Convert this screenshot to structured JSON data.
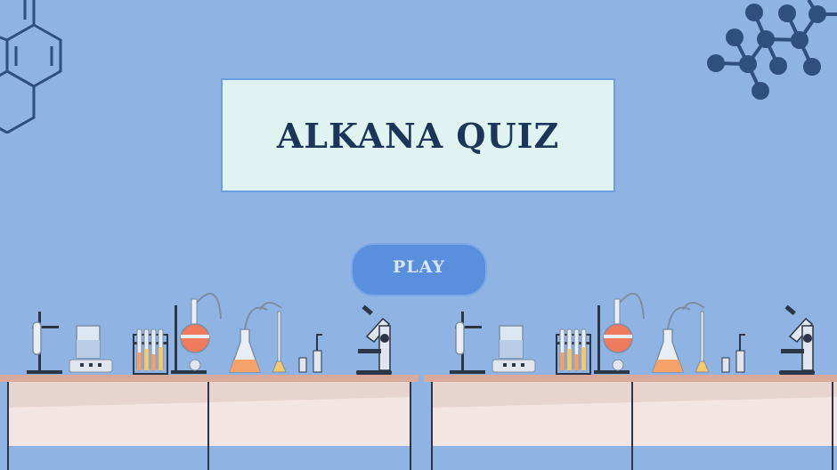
{
  "title": {
    "text": "ALKANA QUIZ"
  },
  "play_button": {
    "label": "PLAY"
  },
  "colors": {
    "background": "#8fb3e3",
    "title_box": "#dff3f0",
    "title_text": "#1c3558",
    "button": "#5a8fdd",
    "molecule": "#2f4f7f",
    "table_top": "#d9a99b",
    "table_body": "#f3e6e2"
  },
  "decorations": [
    "hexagon-molecule-icon",
    "ball-and-stick-molecule-icon",
    "lab-bench",
    "lab-equipment"
  ]
}
